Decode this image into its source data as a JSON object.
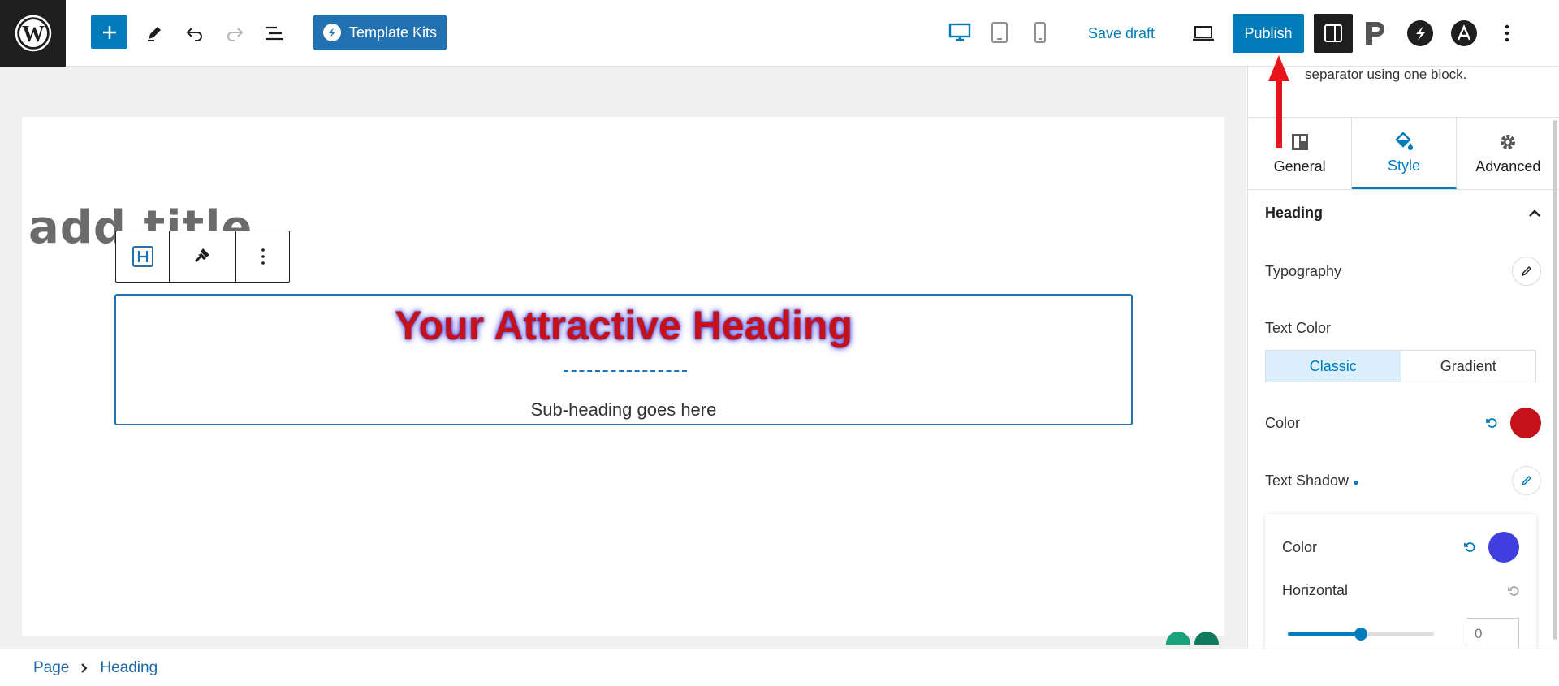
{
  "toolbar": {
    "add_label": "+",
    "template_kits_label": "Template Kits",
    "save_draft_label": "Save draft",
    "publish_label": "Publish"
  },
  "canvas": {
    "page_title": "add title"
  },
  "block": {
    "heading": "Your Attractive Heading",
    "subheading": "Sub-heading goes here",
    "heading_color": "#c5111a",
    "shadow_color": "#4040e0"
  },
  "breadcrumb": {
    "items": [
      "Page",
      "Heading"
    ]
  },
  "sidebar": {
    "description": "separator using one block.",
    "tabs": [
      {
        "label": "General",
        "icon": "layout-icon"
      },
      {
        "label": "Style",
        "icon": "paint-bucket-icon",
        "active": true
      },
      {
        "label": "Advanced",
        "icon": "gear-icon"
      }
    ],
    "section_title": "Heading",
    "typography_label": "Typography",
    "text_color_label": "Text Color",
    "color_modes": [
      "Classic",
      "Gradient"
    ],
    "color_label": "Color",
    "color_value": "#c5111a",
    "text_shadow_label": "Text Shadow",
    "shadow": {
      "color_label": "Color",
      "color_value": "#3f3fe0",
      "horizontal_label": "Horizontal",
      "horizontal_value": "0"
    }
  }
}
